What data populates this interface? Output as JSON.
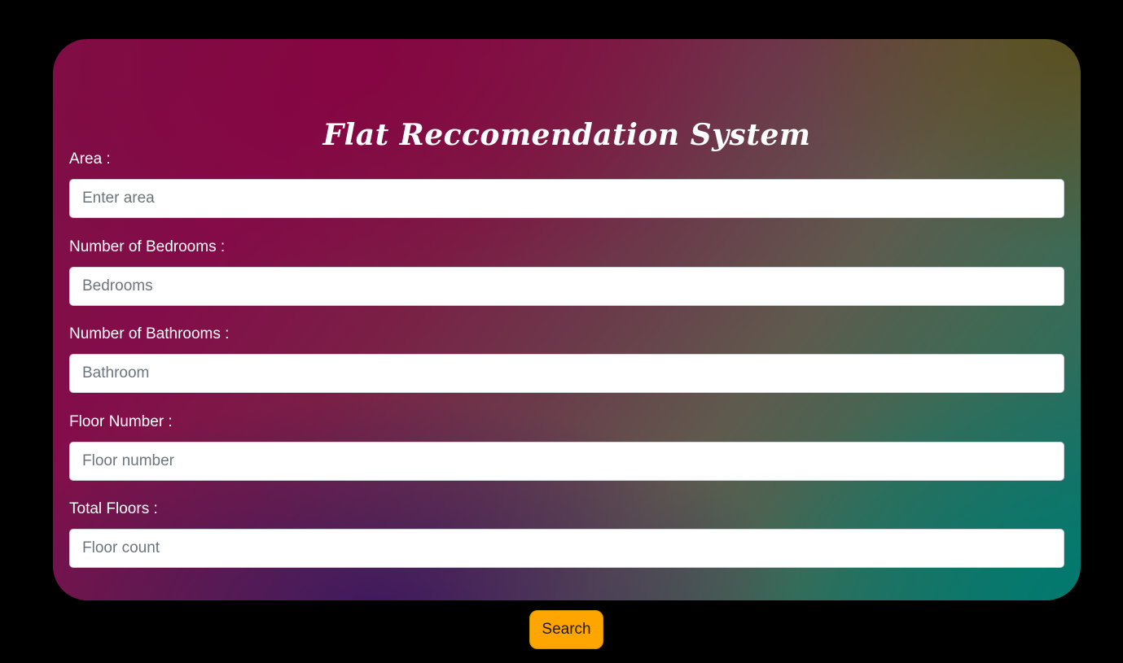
{
  "form": {
    "title": "Flat Reccomendation System",
    "fields": [
      {
        "label": "Area :",
        "placeholder": "Enter area",
        "value": ""
      },
      {
        "label": "Number of Bedrooms :",
        "placeholder": "Bedrooms",
        "value": ""
      },
      {
        "label": "Number of Bathrooms :",
        "placeholder": "Bathroom",
        "value": ""
      },
      {
        "label": "Floor Number :",
        "placeholder": "Floor number",
        "value": ""
      },
      {
        "label": "Total Floors :",
        "placeholder": "Floor count",
        "value": ""
      }
    ],
    "submit_label": "Search"
  },
  "colors": {
    "page_background": "#000000",
    "card_gradient_start": "#7e0f44",
    "card_gradient_mid": "#5f5a4e",
    "card_gradient_end": "#137266",
    "button_background": "#ffa500",
    "text": "#ffffff"
  }
}
